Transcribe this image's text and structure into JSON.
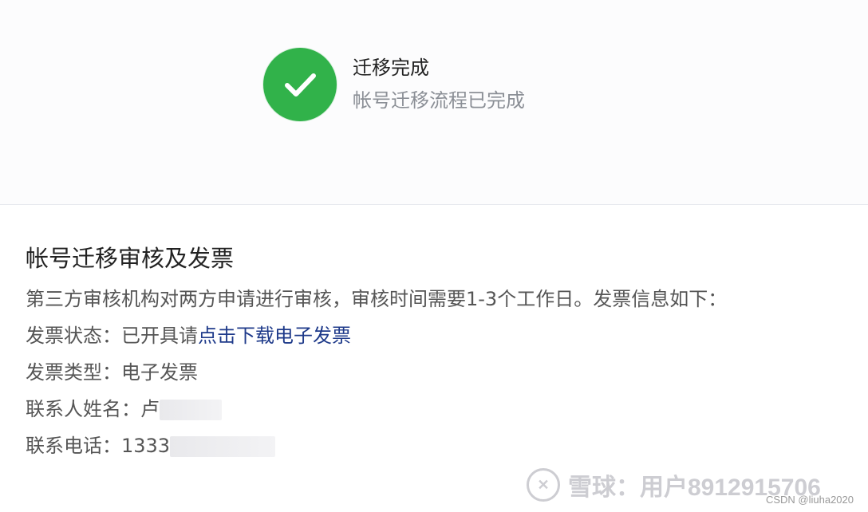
{
  "status": {
    "title": "迁移完成",
    "subtitle": "帐号迁移流程已完成",
    "icon": "check-circle-icon",
    "color": "#31b24a"
  },
  "details": {
    "title": "帐号迁移审核及发票",
    "description": "第三方审核机构对两方申请进行审核，审核时间需要1-3个工作日。发票信息如下：",
    "invoice_status_label": "发票状态：",
    "invoice_status_value": "已开具请",
    "download_link": "点击下载电子发票",
    "invoice_type_label": "发票类型：",
    "invoice_type_value": "电子发票",
    "contact_name_label": "联系人姓名：",
    "contact_name_value": "卢",
    "contact_phone_label": "联系电话：",
    "contact_phone_value": "1333"
  },
  "watermark": {
    "text": "雪球：用户8912915706",
    "icon": "snowball-logo-icon"
  },
  "footer": {
    "credit": "CSDN @liuha2020"
  }
}
